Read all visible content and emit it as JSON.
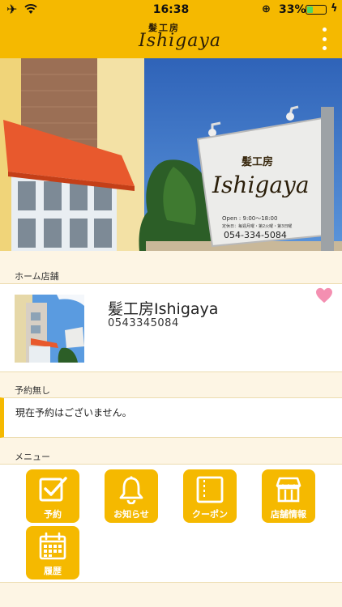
{
  "status_bar": {
    "time": "16:38",
    "battery_percent": "33%",
    "battery_level": 0.33
  },
  "header": {
    "logo_kanji": "髪工房",
    "logo_name": "Ishigaya"
  },
  "hero": {
    "sign_kanji": "髪工房",
    "sign_name": "Ishigaya",
    "sign_hours": "Open : 9:00～18:00",
    "sign_holiday": "定休日：毎週月曜・第2火曜・第3日曜",
    "sign_tel": "054-334-5084"
  },
  "home_store": {
    "section_label": "ホーム店舗",
    "name": "髪工房Ishigaya",
    "tel": "0543345084"
  },
  "reservation": {
    "section_label": "予約無し",
    "message": "現在予約はございません。"
  },
  "menu": {
    "section_label": "メニュー",
    "items": [
      {
        "label": "予約",
        "icon": "checkbox-icon"
      },
      {
        "label": "お知らせ",
        "icon": "bell-icon"
      },
      {
        "label": "クーポン",
        "icon": "coupon-icon"
      },
      {
        "label": "店舗情報",
        "icon": "store-icon"
      },
      {
        "label": "履歴",
        "icon": "calendar-icon"
      }
    ]
  },
  "colors": {
    "accent": "#f5b900",
    "background": "#fdf5e4",
    "heart": "#f48fb1"
  }
}
